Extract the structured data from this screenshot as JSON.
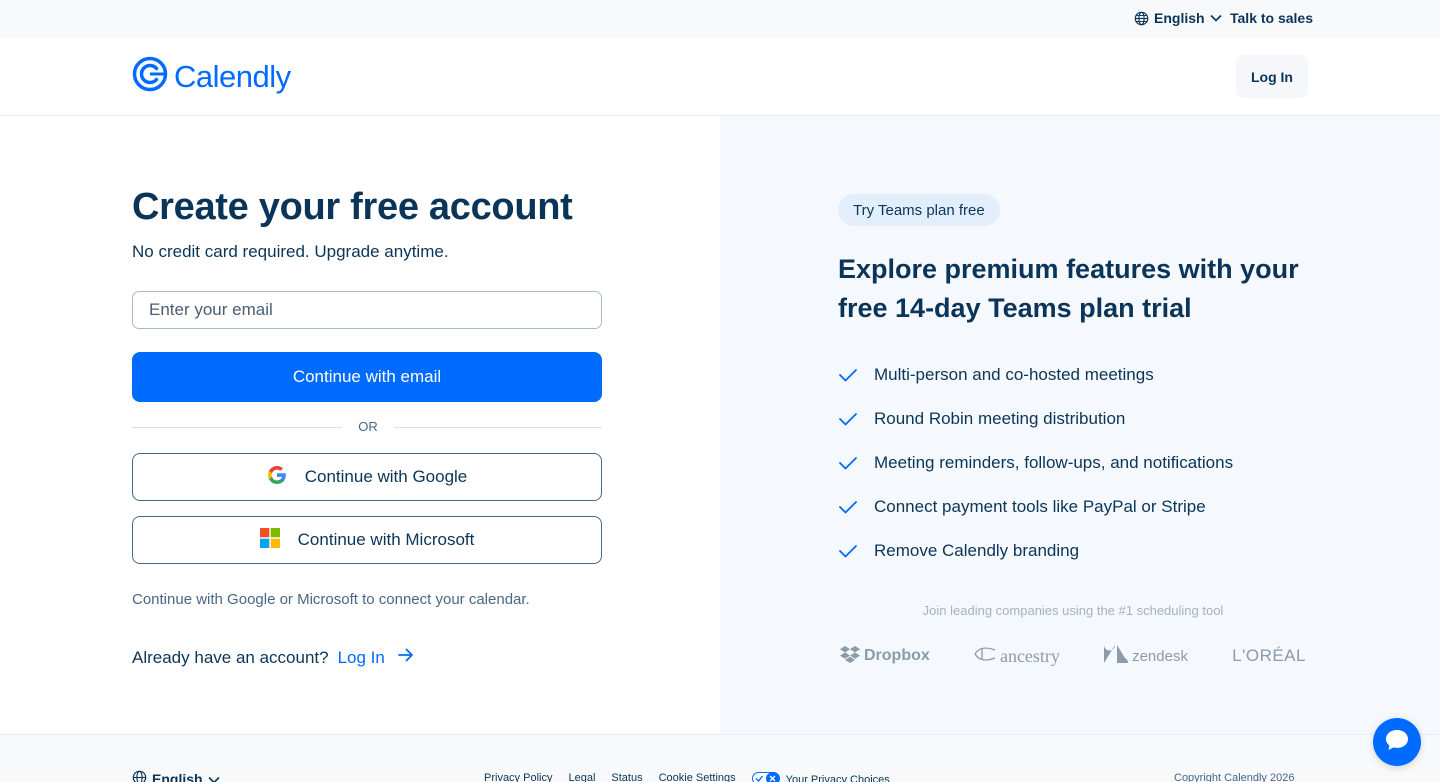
{
  "utility_bar": {
    "language": "English",
    "talk_to_sales": "Talk to sales"
  },
  "header": {
    "logo_text": "Calendly",
    "login_label": "Log In"
  },
  "signup": {
    "title": "Create your free account",
    "subtitle": "No credit card required. Upgrade anytime.",
    "email_placeholder": "Enter your email",
    "email_button": "Continue with email",
    "divider": "OR",
    "google_button": "Continue with Google",
    "microsoft_button": "Continue with Microsoft",
    "oauth_note": "Continue with Google or Microsoft to connect your calendar.",
    "have_account": "Already have an account?",
    "login_link": "Log In"
  },
  "promo": {
    "pill": "Try Teams plan free",
    "heading": "Explore premium features with your free 14-day Teams plan trial",
    "features": [
      "Multi-person and co-hosted meetings",
      "Round Robin meeting distribution",
      "Meeting reminders, follow-ups, and notifications",
      "Connect payment tools like PayPal or Stripe",
      "Remove Calendly branding"
    ],
    "join_text": "Join leading companies using the #1 scheduling tool",
    "logos": [
      "Dropbox",
      "ancestry",
      "zendesk",
      "L'ORÉAL"
    ]
  },
  "footer": {
    "language": "English",
    "links": [
      "Privacy Policy",
      "Legal",
      "Status",
      "Cookie Settings"
    ],
    "privacy_choices": "Your Privacy Choices",
    "copyright": "Copyright Calendly 2026"
  },
  "colors": {
    "brand_blue": "#006bff",
    "navy_text": "#0b3558",
    "right_panel_bg": "#f5f8fc"
  },
  "icons": {
    "globe": "globe-icon",
    "chevron": "chevron-down-icon",
    "check": "check-icon",
    "arrow": "arrow-right-icon",
    "chat": "chat-bubble-icon"
  }
}
